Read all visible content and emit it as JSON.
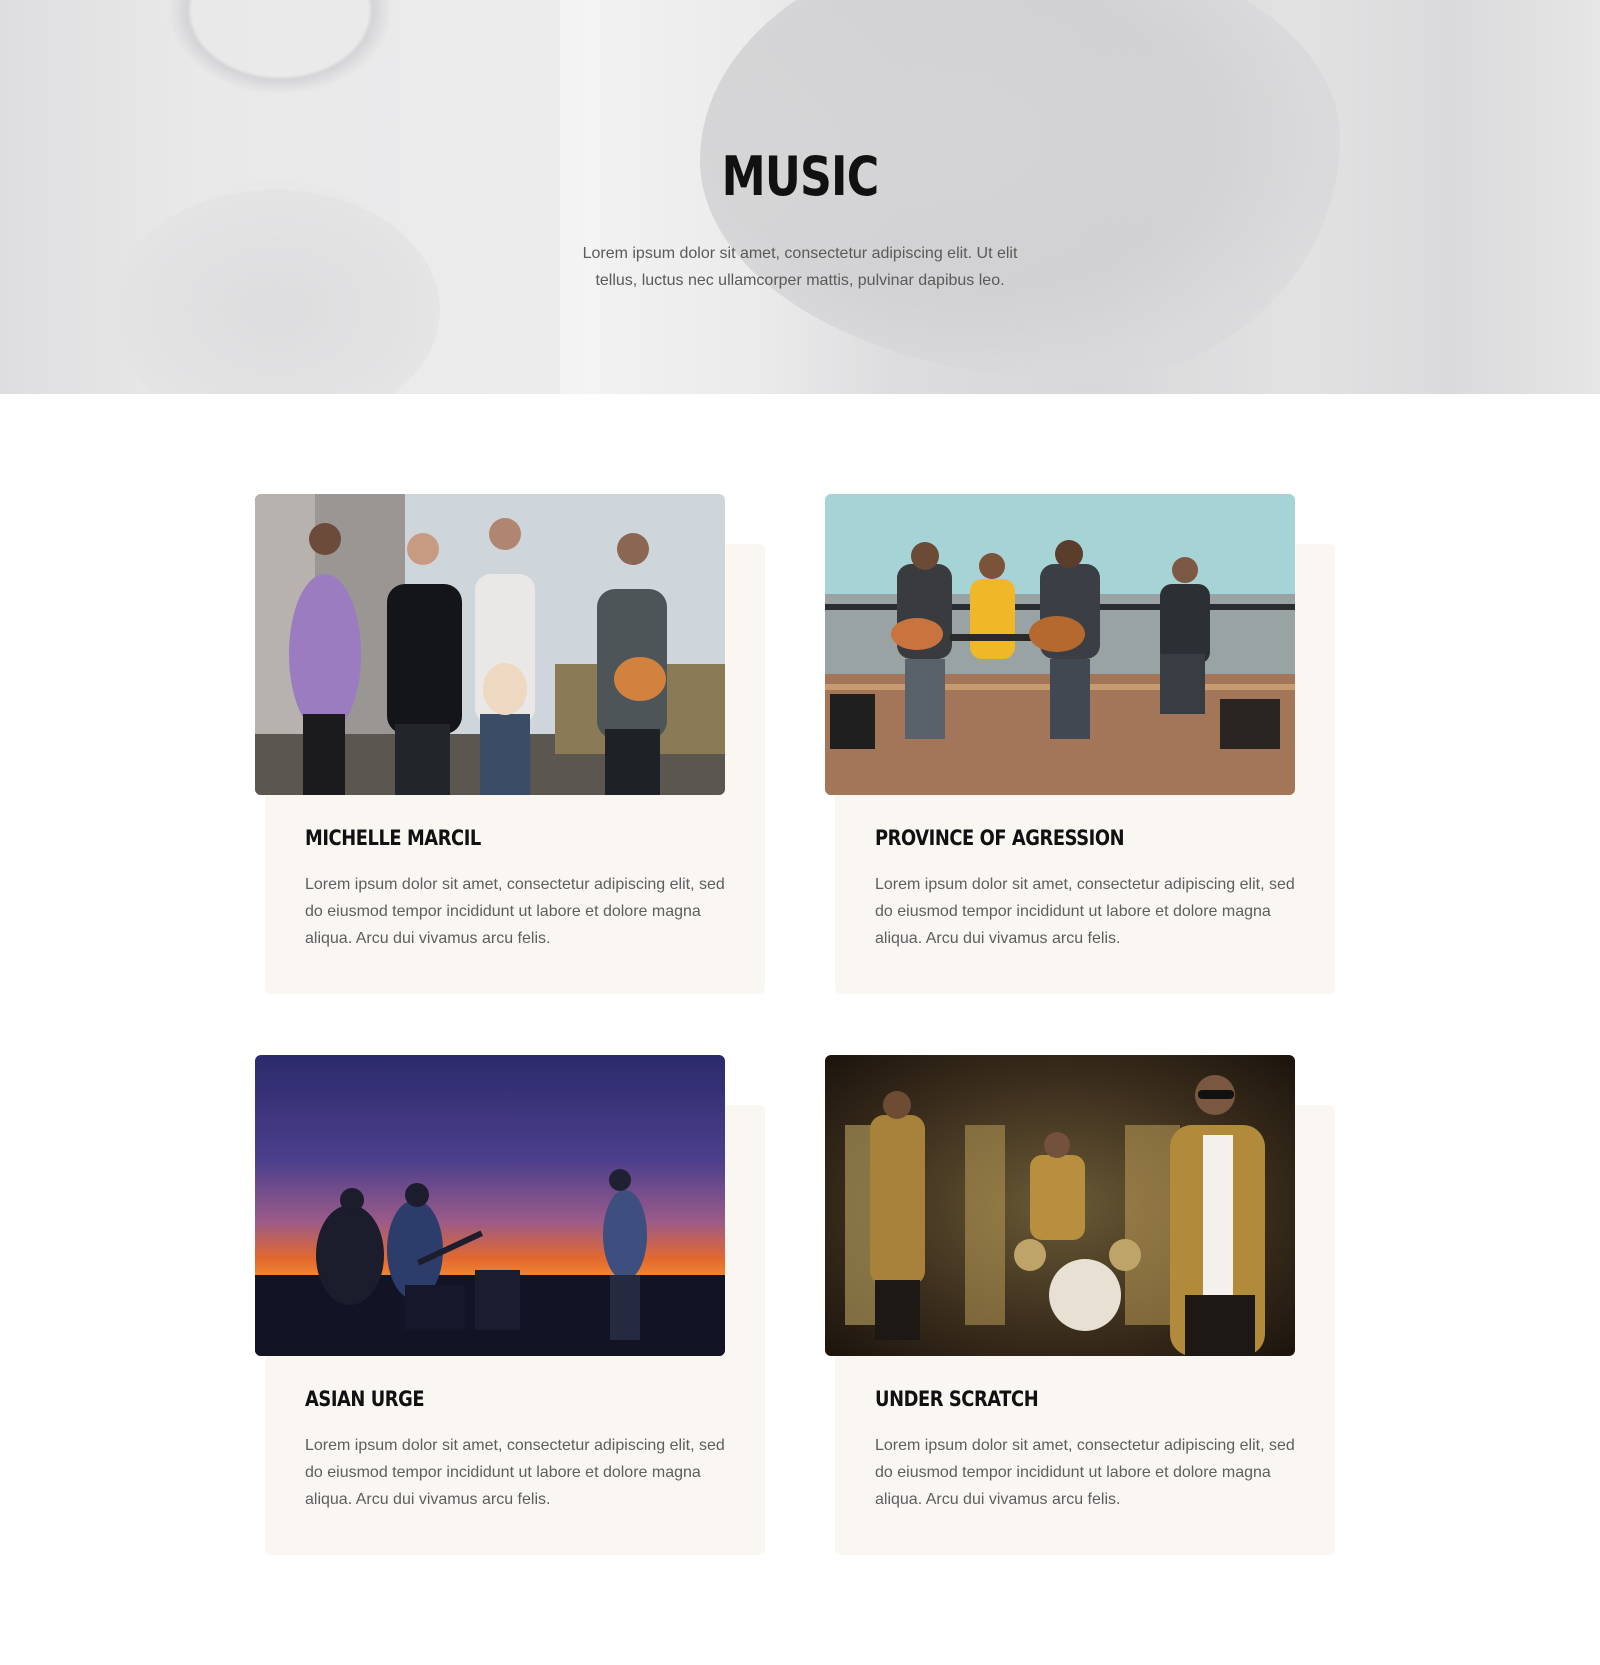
{
  "hero": {
    "title": "MUSIC",
    "text": "Lorem ipsum dolor sit amet, consectetur adipiscing elit. Ut elit tellus, luctus nec ullamcorper mattis, pulvinar dapibus leo."
  },
  "bands": [
    {
      "name": "Michelle Marcil",
      "description": "Lorem ipsum dolor sit amet, consectetur adipiscing elit, sed do eiusmod tempor incididunt ut labore et dolore magna aliqua. Arcu dui vivamus arcu felis."
    },
    {
      "name": "Province of Agression",
      "description": "Lorem ipsum dolor sit amet, consectetur adipiscing elit, sed do eiusmod tempor incididunt ut labore et dolore magna aliqua. Arcu dui vivamus arcu felis."
    },
    {
      "name": "Asian Urge",
      "description": "Lorem ipsum dolor sit amet, consectetur adipiscing elit, sed do eiusmod tempor incididunt ut labore et dolore magna aliqua. Arcu dui vivamus arcu felis."
    },
    {
      "name": "Under Scratch",
      "description": "Lorem ipsum dolor sit amet, consectetur adipiscing elit, sed do eiusmod tempor incididunt ut labore et dolore magna aliqua. Arcu dui vivamus arcu felis."
    }
  ],
  "colors": {
    "card_background": "#faf7f2",
    "heading": "#111111",
    "body_text": "#5e5e5e"
  }
}
